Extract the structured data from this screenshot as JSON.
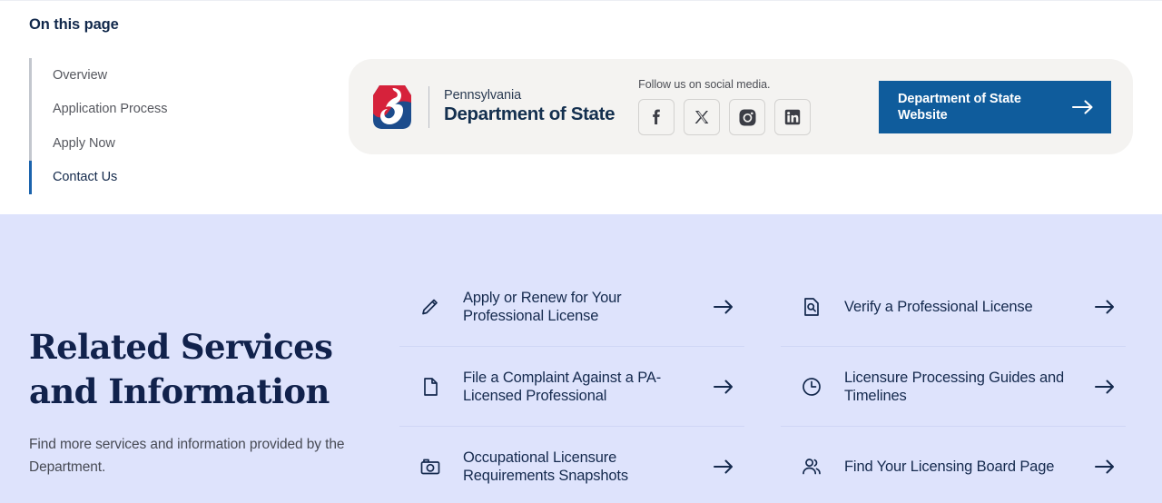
{
  "toc": {
    "title": "On this page",
    "items": [
      {
        "label": "Overview",
        "active": false
      },
      {
        "label": "Application Process",
        "active": false
      },
      {
        "label": "Apply Now",
        "active": false
      },
      {
        "label": "Contact Us",
        "active": true
      }
    ]
  },
  "agency_banner": {
    "logo": {
      "icon": "pa-keystone-logo",
      "line1": "Pennsylvania",
      "line2": "Department of State",
      "red": "#d6223b",
      "blue": "#1c4c8c"
    },
    "social": {
      "label": "Follow us on social media.",
      "items": [
        {
          "name": "facebook-icon",
          "title": "Facebook"
        },
        {
          "name": "x-twitter-icon",
          "title": "X"
        },
        {
          "name": "instagram-icon",
          "title": "Instagram"
        },
        {
          "name": "linkedin-icon",
          "title": "LinkedIn"
        }
      ]
    },
    "cta": {
      "label": "Department of State Website",
      "icon": "arrow-right-icon",
      "background": "#0f5c9c",
      "text_color": "#ffffff"
    },
    "card_background": "#f4f3f1"
  },
  "related": {
    "heading": "Related Services and Information",
    "subtitle": "Find more services and information provided by the Department.",
    "background": "#dee3fc",
    "left_column": [
      {
        "icon": "pencil-icon",
        "label": "Apply or Renew for Your Professional License"
      },
      {
        "icon": "document-icon",
        "label": "File a Complaint Against a PA-Licensed Professional"
      },
      {
        "icon": "camera-icon",
        "label": "Occupational Licensure Requirements Snapshots"
      }
    ],
    "right_column": [
      {
        "icon": "document-search-icon",
        "label": "Verify a Professional License"
      },
      {
        "icon": "clock-icon",
        "label": "Licensure Processing Guides and Timelines"
      },
      {
        "icon": "people-icon",
        "label": "Find Your Licensing Board Page"
      }
    ],
    "arrow_icon": "arrow-right-icon"
  },
  "colors": {
    "navy": "#11224c",
    "accent_blue": "#1b63ad",
    "lavender": "#dee3fc"
  }
}
